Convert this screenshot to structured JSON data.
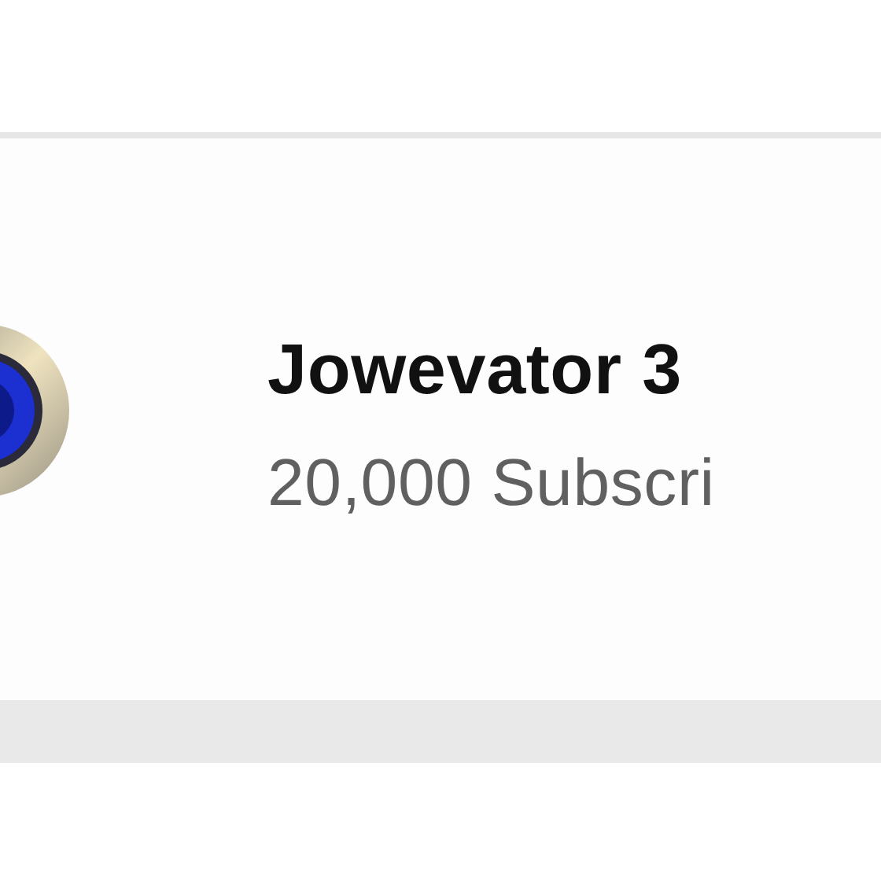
{
  "channel": {
    "name": "Jowevator 3",
    "subscribers": "20,000 Subscri"
  }
}
